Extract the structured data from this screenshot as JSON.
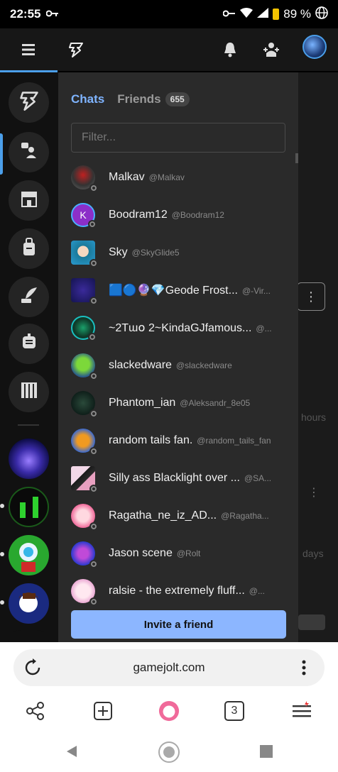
{
  "status_bar": {
    "time": "22:55",
    "battery": "89 %"
  },
  "panel": {
    "tabs": {
      "chats": "Chats",
      "friends": "Friends",
      "friends_count": "655"
    },
    "filter_placeholder": "Filter...",
    "chats": [
      {
        "name": "Malkav",
        "handle": "@Malkav"
      },
      {
        "name": "Boodram12",
        "handle": "@Boodram12",
        "initial": "K"
      },
      {
        "name": "Sky",
        "handle": "@SkyGlide5"
      },
      {
        "name": "🟦🔵🔮💎Geode Frost...",
        "handle": "@-Vir..."
      },
      {
        "name": "~2Tɯ໐ 2~KindaGJfamous...",
        "handle": "@..."
      },
      {
        "name": "slackedware",
        "handle": "@slackedware"
      },
      {
        "name": "Phantom_ian",
        "handle": "@Aleksandr_8e05"
      },
      {
        "name": "random tails fan.",
        "handle": "@random_tails_fan"
      },
      {
        "name": "Silly ass Blacklight over ...",
        "handle": "@SA..."
      },
      {
        "name": "Ragatha_ne_iz_AD...",
        "handle": "@Ragatha..."
      },
      {
        "name": "Jason scene",
        "handle": "@Rolt"
      },
      {
        "name": "ralsie - the extremely fluff...",
        "handle": "@..."
      }
    ],
    "invite_label": "Invite a friend"
  },
  "background": {
    "text_hours": "hours",
    "text_days": "days"
  },
  "browser": {
    "url": "gamejolt.com",
    "tab_count": "3"
  },
  "colors": {
    "accent": "#7fb4ff",
    "invite": "#8cb6ff",
    "panel": "#2a2a2a",
    "rail": "#111111"
  }
}
